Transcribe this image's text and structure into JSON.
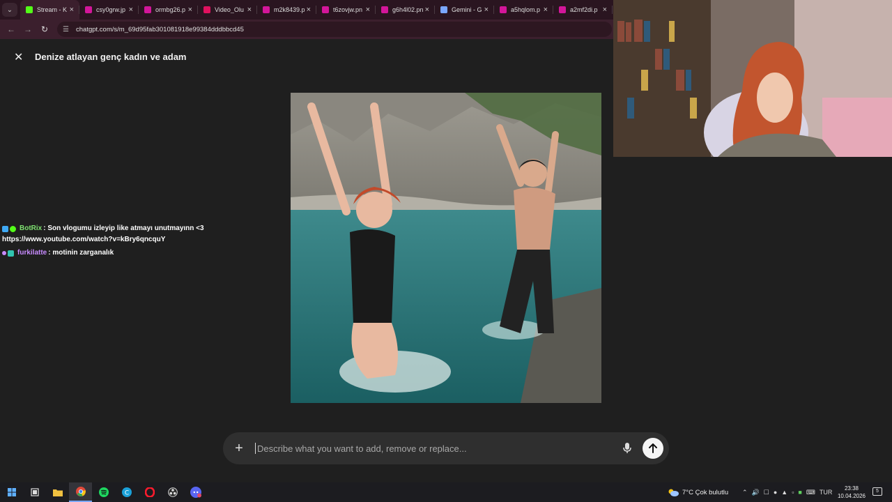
{
  "browser": {
    "tabs": [
      {
        "title": "Stream - K",
        "color": "#53fc18"
      },
      {
        "title": "csy0grw.jp",
        "color": "#d3169a"
      },
      {
        "title": "ormbg26.p",
        "color": "#d3169a"
      },
      {
        "title": "Video_Olu",
        "color": "#e0115f"
      },
      {
        "title": "m2k8439.p",
        "color": "#d3169a"
      },
      {
        "title": "t6zovjw.pn",
        "color": "#d3169a"
      },
      {
        "title": "g6h4l02.pn",
        "color": "#d3169a"
      },
      {
        "title": "Gemini - G",
        "color": "#7aa7ff"
      },
      {
        "title": "a5hqlom.p",
        "color": "#d3169a"
      },
      {
        "title": "a2mf2di.p",
        "color": "#d3169a"
      }
    ],
    "url": "chatgpt.com/s/m_69d95fab301081918e99384dddbbcd45"
  },
  "viewer": {
    "title": "Denize atlayan genç kadın ve adam"
  },
  "chat": {
    "messages": [
      {
        "user": "BotRix",
        "text": ": Son vlogumu izleyip like atmayı unutmayınn <3",
        "text2": "https://www.youtube.com/watch?v=kBry6qncquY"
      },
      {
        "user": "furkilatte",
        "text": ": motinin zarganalık"
      }
    ]
  },
  "prompt": {
    "placeholder": "Describe what you want to add, remove or replace..."
  },
  "taskbar": {
    "weather": "7°C  Çok bulutlu",
    "lang": "TUR",
    "time": "23:38",
    "date": "10.04.2026",
    "notif_count": "5"
  }
}
